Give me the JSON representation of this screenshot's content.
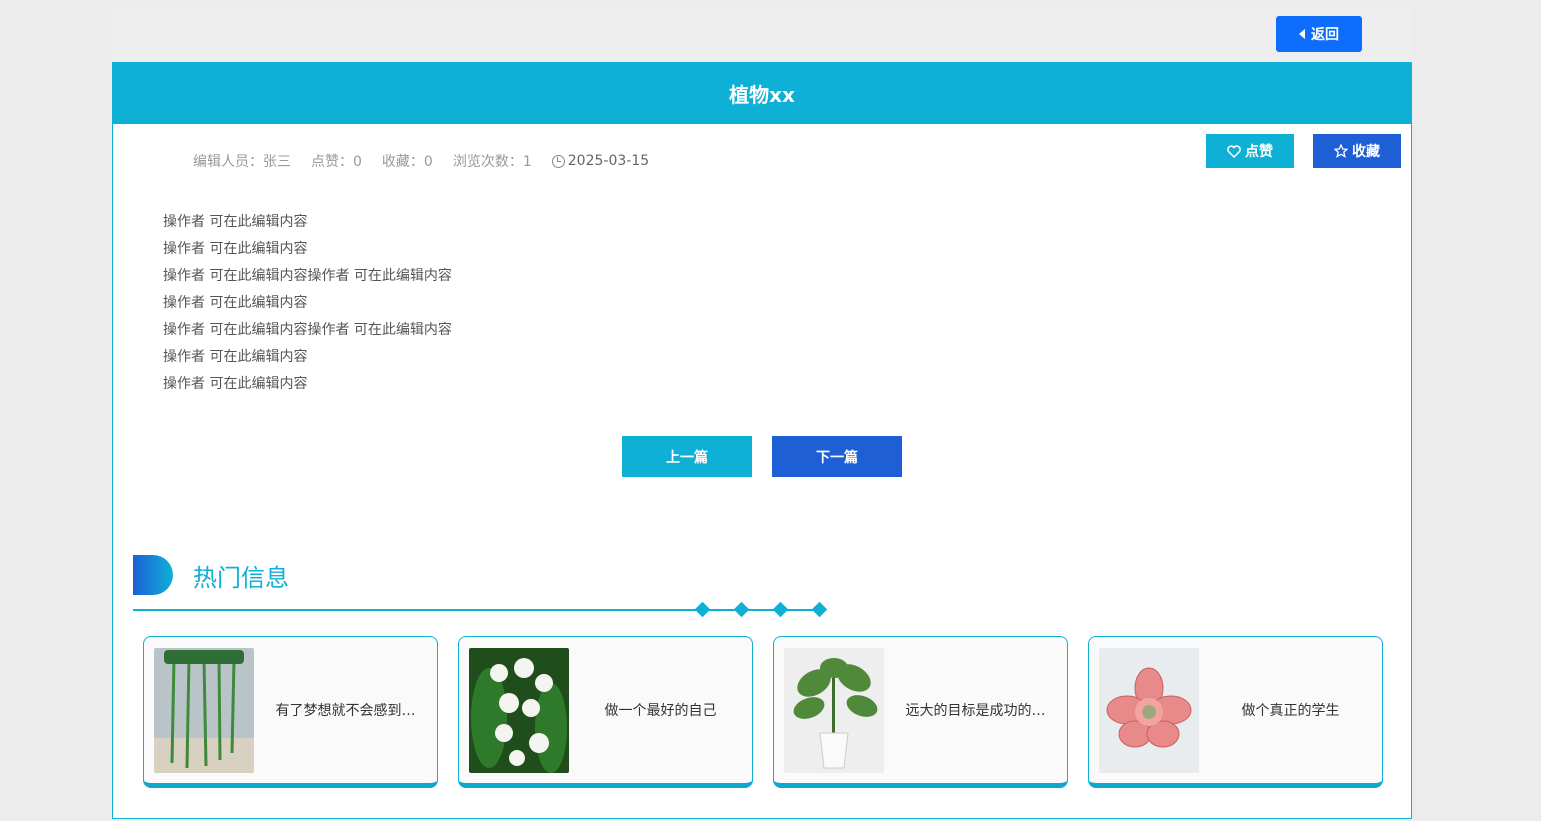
{
  "header": {
    "back_label": "返回"
  },
  "article": {
    "title": "植物xx",
    "editor": "编辑人员：张三",
    "likes": "点赞：0",
    "favorites": "收藏：0",
    "views": "浏览次数：1",
    "date": "2025-03-15",
    "like_label": "点赞",
    "fav_label": "收藏",
    "lines": [
      "操作者 可在此编辑内容",
      "操作者 可在此编辑内容",
      "操作者 可在此编辑内容操作者 可在此编辑内容",
      "操作者 可在此编辑内容",
      "操作者 可在此编辑内容操作者 可在此编辑内容",
      "操作者 可在此编辑内容",
      "操作者 可在此编辑内容"
    ],
    "prev_label": "上一篇",
    "next_label": "下一篇"
  },
  "hot": {
    "title": "热门信息",
    "items": [
      {
        "title": "有了梦想就不会感到…",
        "icon": "hanging-plant-image"
      },
      {
        "title": "做一个最好的自己",
        "icon": "lily-of-valley-image"
      },
      {
        "title": "远大的目标是成功的…",
        "icon": "potted-plant-image"
      },
      {
        "title": "做个真正的学生",
        "icon": "succulent-image"
      }
    ]
  },
  "colors": {
    "primary": "#0fb0d6",
    "secondary": "#1e5fd6",
    "back": "#0d6efd"
  }
}
